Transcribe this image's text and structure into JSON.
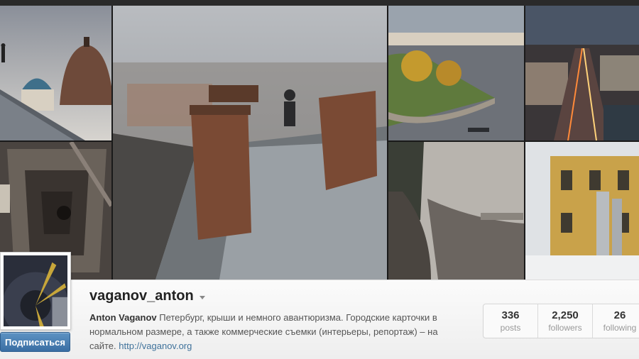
{
  "profile": {
    "username": "vaganov_anton",
    "full_name": "Anton Vaganov",
    "bio": " Петербург, крыши и немного авантюризма. Городские карточки в нормальном размере, а также коммерческие съемки (интерьеры, репортаж) – на сайте. ",
    "website": "http://vaganov.org",
    "follow_label": "Подписаться"
  },
  "stats": [
    {
      "value": "336",
      "label": "posts"
    },
    {
      "value": "2,250",
      "label": "followers"
    },
    {
      "value": "26",
      "label": "following"
    }
  ],
  "icons": {
    "dropdown": "caret-down-icon"
  }
}
